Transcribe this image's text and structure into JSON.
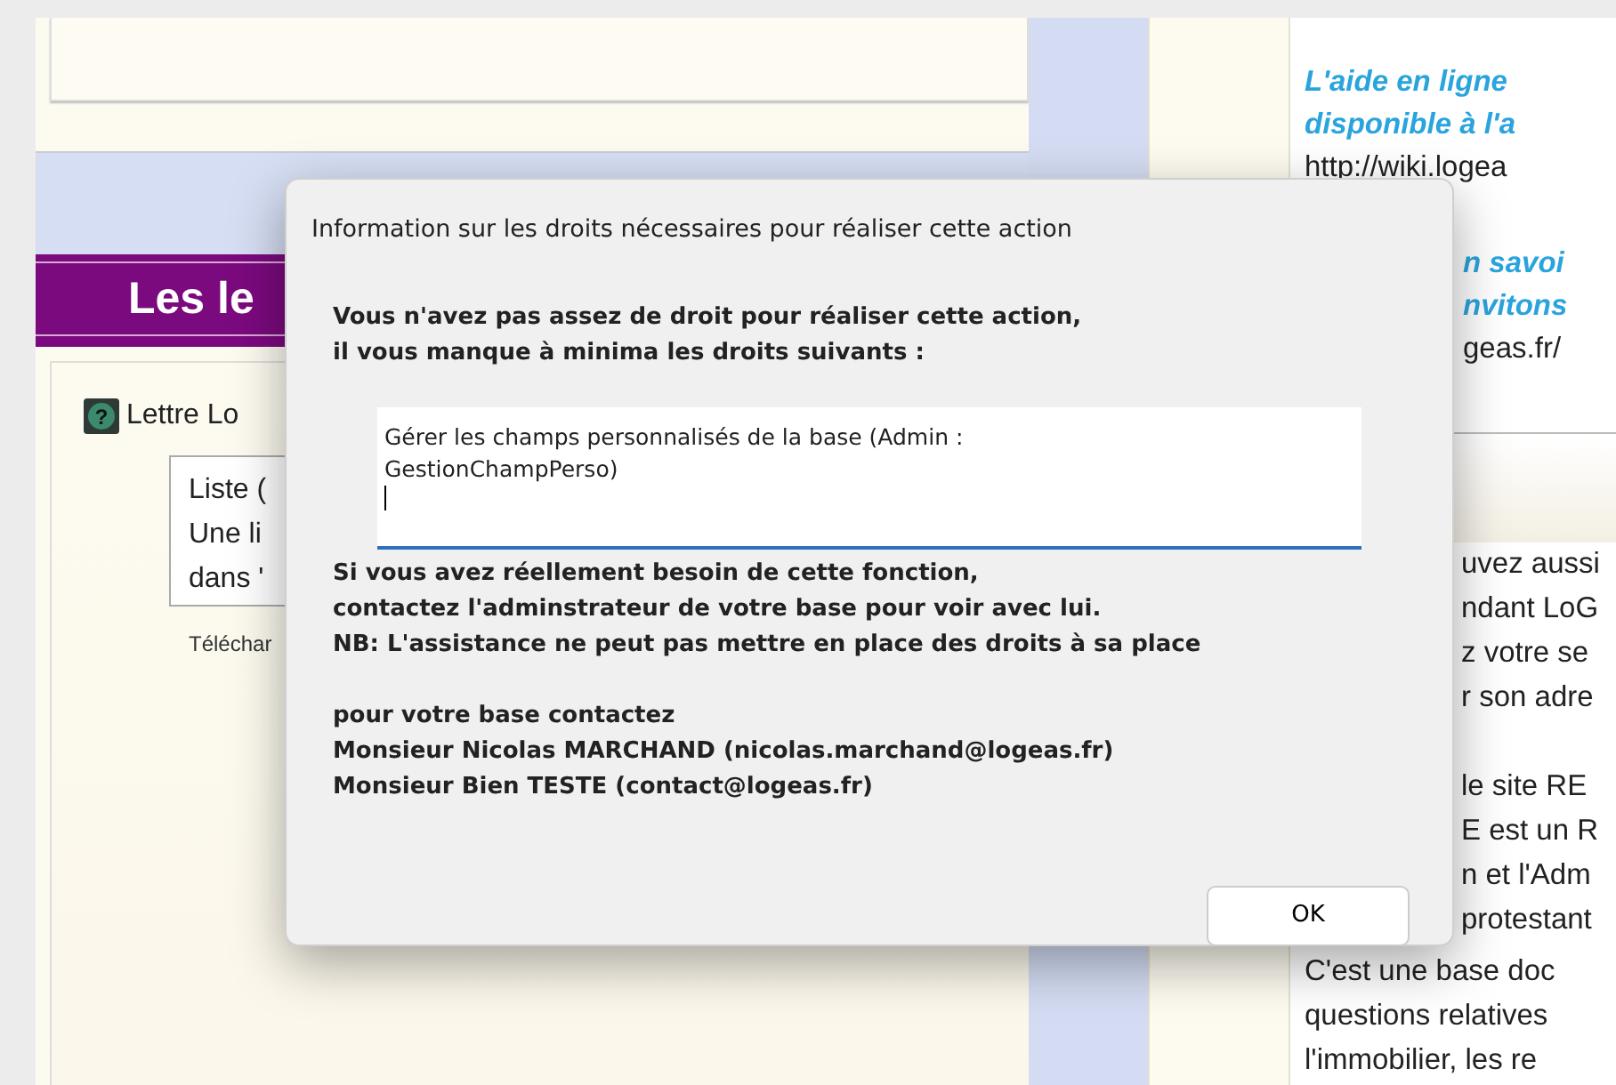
{
  "left_panel": {
    "heading": "Les le",
    "help_icon_glyph": "?",
    "item_title": "Lettre Lo",
    "box_lines": [
      "Liste (",
      "Une li",
      "dans '"
    ],
    "download_link": "Téléchar"
  },
  "right_panel": {
    "above_dialog": [
      {
        "text": "L'aide en ligne",
        "kind": "highlight"
      },
      {
        "text": "disponible à l'a",
        "kind": "highlight"
      },
      {
        "text": "http://wiki.logea",
        "kind": "plain"
      }
    ],
    "beside_dialog_top": [
      {
        "text": "n savoi",
        "kind": "highlight"
      },
      {
        "text": "nvitons",
        "kind": "highlight"
      },
      {
        "text": "geas.fr/",
        "kind": "plain"
      }
    ],
    "beside_dialog_bottom": [
      [
        {
          "text": "uvez aussi",
          "kind": "plain"
        },
        {
          "text": "ndant LoG",
          "kind": "plain"
        },
        {
          "text": "z votre se",
          "kind": "plain"
        },
        {
          "text": "r son adre",
          "kind": "plain"
        }
      ],
      [
        {
          "text": "le site RE",
          "kind": "plain"
        },
        {
          "text": "E est un R",
          "kind": "plain"
        },
        {
          "text": "n et l'Adm",
          "kind": "plain"
        },
        {
          "text": "protestant",
          "kind": "plain"
        }
      ]
    ],
    "below_dialog": [
      {
        "text": "C'est une base doc",
        "kind": "plain"
      },
      {
        "text": "questions relatives",
        "kind": "plain"
      },
      {
        "text": "l'immobilier, les re",
        "kind": "plain"
      }
    ]
  },
  "dialog": {
    "title": "Information sur les droits nécessaires pour réaliser cette action",
    "intro": [
      "Vous n'avez pas assez de droit pour réaliser cette action,",
      "il vous manque à minima les droits suivants :"
    ],
    "rights_field": "Gérer les champs personnalisés de la base (Admin : GestionChampPerso)",
    "advice": [
      "Si vous avez réellement besoin de cette fonction,",
      "contactez l'adminstrateur de votre base pour voir avec lui.",
      "NB: L'assistance ne peut pas mettre en place des droits à sa place"
    ],
    "contacts": [
      "pour votre base contactez",
      "Monsieur Nicolas MARCHAND (nicolas.marchand@logeas.fr)",
      "Monsieur Bien TESTE (contact@logeas.fr)"
    ],
    "buttons": [
      "OK"
    ]
  }
}
